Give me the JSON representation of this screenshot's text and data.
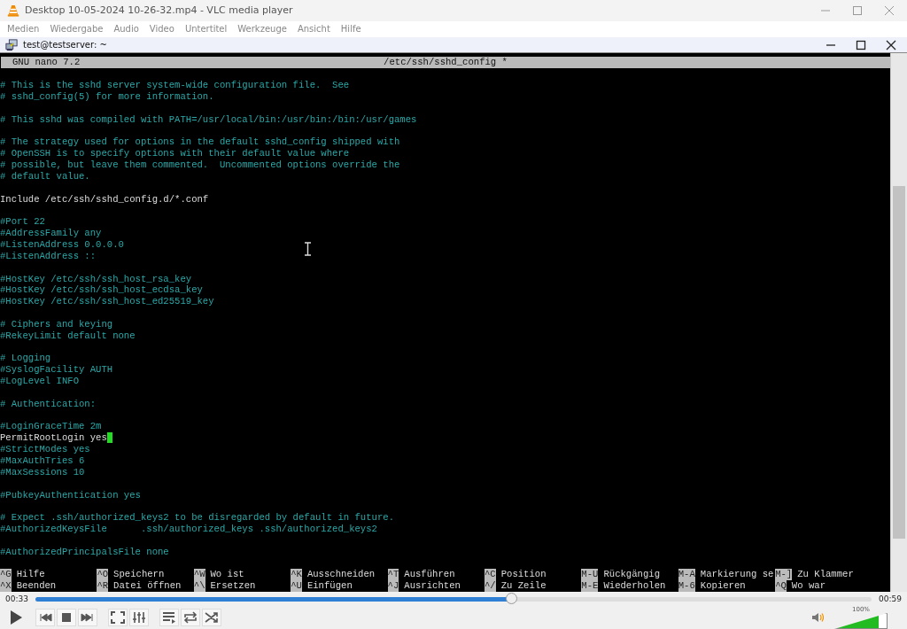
{
  "window": {
    "title": "Desktop 10-05-2024 10-26-32.mp4 - VLC media player"
  },
  "menu": [
    "Medien",
    "Wiedergabe",
    "Audio",
    "Video",
    "Untertitel",
    "Werkzeuge",
    "Ansicht",
    "Hilfe"
  ],
  "terminal_window": {
    "title": "test@testserver: ~"
  },
  "nano": {
    "version": "GNU nano 7.2",
    "filename": "/etc/ssh/sshd_config *"
  },
  "lines": [
    {
      "kind": "blank"
    },
    {
      "kind": "comment",
      "text": "# This is the sshd server system-wide configuration file.  See",
      "cursor": false
    },
    {
      "kind": "comment",
      "text": "# sshd_config(5) for more information.",
      "cursor": false
    },
    {
      "kind": "blank"
    },
    {
      "kind": "comment",
      "text": "# This sshd was compiled with PATH=/usr/local/bin:/usr/bin:/bin:/usr/games",
      "cursor": false
    },
    {
      "kind": "blank"
    },
    {
      "kind": "comment",
      "text": "# The strategy used for options in the default sshd_config shipped with",
      "cursor": false
    },
    {
      "kind": "comment",
      "text": "# OpenSSH is to specify options with their default value where",
      "cursor": false
    },
    {
      "kind": "comment",
      "text": "# possible, but leave them commented.  Uncommented options override the",
      "cursor": false
    },
    {
      "kind": "comment",
      "text": "# default value.",
      "cursor": false
    },
    {
      "kind": "blank"
    },
    {
      "kind": "setting",
      "text": "Include /etc/ssh/sshd_config.d/*.conf",
      "cursor": false
    },
    {
      "kind": "blank"
    },
    {
      "kind": "comment",
      "text": "#Port 22",
      "cursor": false
    },
    {
      "kind": "comment",
      "text": "#AddressFamily any",
      "cursor": false
    },
    {
      "kind": "comment",
      "text": "#ListenAddress 0.0.0.0",
      "cursor": false
    },
    {
      "kind": "comment",
      "text": "#ListenAddress ::",
      "cursor": false
    },
    {
      "kind": "blank"
    },
    {
      "kind": "comment",
      "text": "#HostKey /etc/ssh/ssh_host_rsa_key",
      "cursor": false
    },
    {
      "kind": "comment",
      "text": "#HostKey /etc/ssh/ssh_host_ecdsa_key",
      "cursor": false
    },
    {
      "kind": "comment",
      "text": "#HostKey /etc/ssh/ssh_host_ed25519_key",
      "cursor": false
    },
    {
      "kind": "blank"
    },
    {
      "kind": "comment",
      "text": "# Ciphers and keying",
      "cursor": false
    },
    {
      "kind": "comment",
      "text": "#RekeyLimit default none",
      "cursor": false
    },
    {
      "kind": "blank"
    },
    {
      "kind": "comment",
      "text": "# Logging",
      "cursor": false
    },
    {
      "kind": "comment",
      "text": "#SyslogFacility AUTH",
      "cursor": false
    },
    {
      "kind": "comment",
      "text": "#LogLevel INFO",
      "cursor": false
    },
    {
      "kind": "blank"
    },
    {
      "kind": "comment",
      "text": "# Authentication:",
      "cursor": false
    },
    {
      "kind": "blank"
    },
    {
      "kind": "comment",
      "text": "#LoginGraceTime 2m",
      "cursor": false
    },
    {
      "kind": "setting",
      "text": "PermitRootLogin yes",
      "cursor": true
    },
    {
      "kind": "comment",
      "text": "#StrictModes yes",
      "cursor": false
    },
    {
      "kind": "comment",
      "text": "#MaxAuthTries 6",
      "cursor": false
    },
    {
      "kind": "comment",
      "text": "#MaxSessions 10",
      "cursor": false
    },
    {
      "kind": "blank"
    },
    {
      "kind": "comment",
      "text": "#PubkeyAuthentication yes",
      "cursor": false
    },
    {
      "kind": "blank"
    },
    {
      "kind": "comment",
      "text": "# Expect .ssh/authorized_keys2 to be disregarded by default in future.",
      "cursor": false
    },
    {
      "kind": "comment",
      "text": "#AuthorizedKeysFile      .ssh/authorized_keys .ssh/authorized_keys2",
      "cursor": false
    },
    {
      "kind": "blank"
    },
    {
      "kind": "comment",
      "text": "#AuthorizedPrincipalsFile none",
      "cursor": false
    },
    {
      "kind": "blank"
    }
  ],
  "shortcuts": [
    [
      {
        "key": "^G",
        "label": "Hilfe"
      },
      {
        "key": "^O",
        "label": "Speichern"
      },
      {
        "key": "^W",
        "label": "Wo ist"
      },
      {
        "key": "^K",
        "label": "Ausschneiden"
      },
      {
        "key": "^T",
        "label": "Ausführen"
      },
      {
        "key": "^C",
        "label": "Position"
      },
      {
        "key": "M-U",
        "label": "Rückgängig"
      },
      {
        "key": "M-A",
        "label": "Markierung se"
      },
      {
        "key": "M-]",
        "label": "Zu Klammer"
      }
    ],
    [
      {
        "key": "^X",
        "label": "Beenden"
      },
      {
        "key": "^R",
        "label": "Datei öffnen"
      },
      {
        "key": "^\\",
        "label": "Ersetzen"
      },
      {
        "key": "^U",
        "label": "Einfügen"
      },
      {
        "key": "^J",
        "label": "Ausrichten"
      },
      {
        "key": "^/",
        "label": "Zu Zeile"
      },
      {
        "key": "M-E",
        "label": "Wiederholen"
      },
      {
        "key": "M-6",
        "label": "Kopieren"
      },
      {
        "key": "^Q",
        "label": "Wo war"
      }
    ]
  ],
  "player": {
    "elapsed": "00:33",
    "total": "00:59",
    "level": 0.57,
    "volume": {
      "reading": "100%",
      "level": 0.85
    }
  }
}
